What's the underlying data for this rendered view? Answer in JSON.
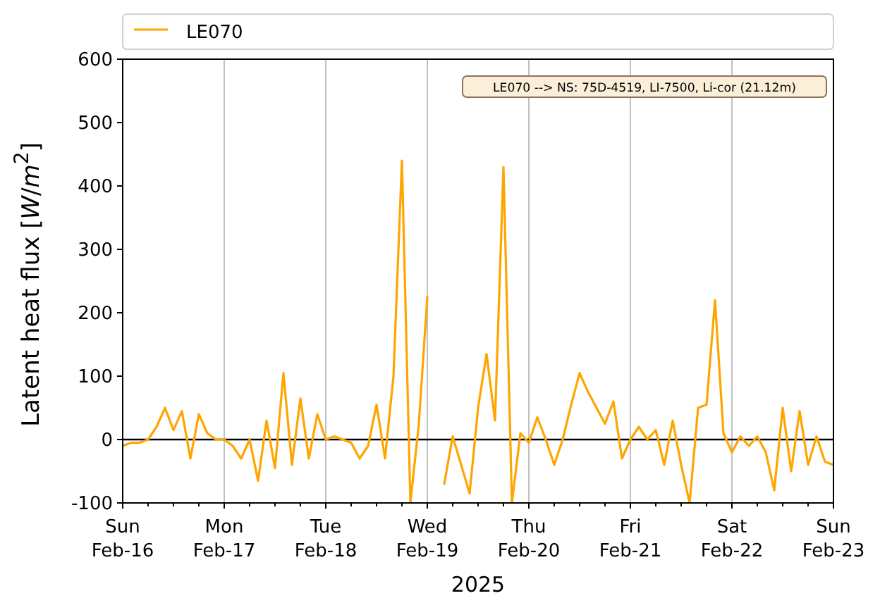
{
  "chart": {
    "annotation": "LE070 --> NS: 75D-4519, LI-7500, Li-cor (21.12m)",
    "chart_data": {
      "type": "line",
      "grid": "x",
      "xlabel": "2025",
      "ylabel": "Latent heat flux [*W*/*m*$^{2}$]",
      "ylim": [
        -100,
        600
      ],
      "yticks": [
        -100,
        0,
        100,
        200,
        300,
        400,
        500,
        600
      ],
      "categories": [
        "Sun\nFeb-16",
        null,
        null,
        null,
        null,
        null,
        null,
        null,
        null,
        null,
        null,
        null,
        "Mon\nFeb-17",
        null,
        null,
        null,
        null,
        null,
        null,
        null,
        null,
        null,
        null,
        null,
        "Tue\nFeb-18",
        null,
        null,
        null,
        null,
        null,
        null,
        null,
        null,
        null,
        null,
        null,
        "Wed\nFeb-19",
        null,
        null,
        null,
        null,
        null,
        null,
        null,
        null,
        null,
        null,
        null,
        "Thu\nFeb-20",
        null,
        null,
        null,
        null,
        null,
        null,
        null,
        null,
        null,
        null,
        null,
        "Fri\nFeb-21",
        null,
        null,
        null,
        null,
        null,
        null,
        null,
        null,
        null,
        null,
        null,
        "Sat\nFeb-22",
        null,
        null,
        null,
        null,
        null,
        null,
        null,
        null,
        null,
        null,
        null,
        "Sun\nFeb-23"
      ],
      "series": [
        {
          "name": "LE070",
          "color": "#ffa500",
          "values": [
            -10,
            -5,
            -5,
            0,
            20,
            50,
            15,
            45,
            -30,
            40,
            10,
            0,
            0,
            -10,
            -30,
            0,
            -65,
            30,
            -45,
            105,
            -40,
            65,
            -30,
            40,
            0,
            5,
            0,
            -5,
            -30,
            -10,
            55,
            -30,
            100,
            440,
            -100,
            25,
            225,
            null,
            -70,
            5,
            -40,
            -85,
            50,
            135,
            30,
            430,
            -100,
            10,
            -5,
            35,
            0,
            -40,
            0,
            55,
            105,
            75,
            50,
            25,
            60,
            -30,
            0,
            20,
            0,
            15,
            -40,
            30,
            -40,
            -100,
            50,
            55,
            220,
            10,
            -20,
            5,
            -10,
            5,
            -20,
            -80,
            50,
            -50,
            45,
            -40,
            5,
            -35,
            -40
          ]
        }
      ]
    }
  }
}
